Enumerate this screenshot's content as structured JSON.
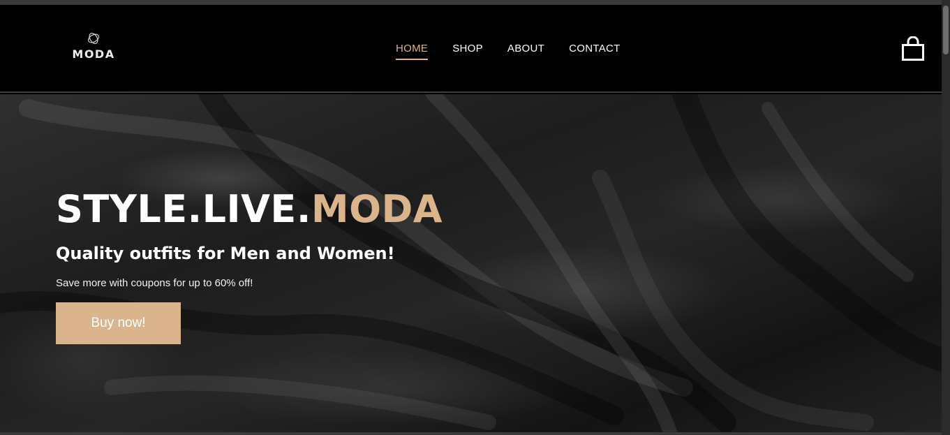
{
  "brand": {
    "name": "MODA",
    "accent_color": "#d9b48c"
  },
  "nav": {
    "items": [
      {
        "label": "HOME",
        "active": true
      },
      {
        "label": "SHOP",
        "active": false
      },
      {
        "label": "ABOUT",
        "active": false
      },
      {
        "label": "CONTACT",
        "active": false
      }
    ]
  },
  "header": {
    "cart_icon": "shopping-bag-icon"
  },
  "hero": {
    "title_main": "STYLE.LIVE.",
    "title_accent": "MODA",
    "subtitle": "Quality outfits for Men and Women!",
    "text": "Save more with coupons for up to 60% off!",
    "button_label": "Buy now!"
  }
}
